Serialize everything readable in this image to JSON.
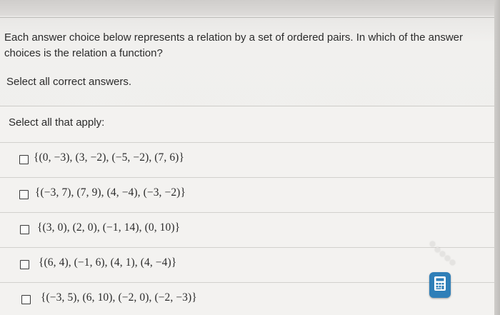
{
  "question": {
    "text": "Each answer choice below represents a relation by a set of ordered pairs. In which of the answer choices is the relation a function?",
    "instruction": "Select all correct answers."
  },
  "answer_panel": {
    "label": "Select all that apply:",
    "options": [
      {
        "text": "{(0, −3), (3, −2), (−5, −2), (7, 6)}",
        "checked": false
      },
      {
        "text": "{(−3, 7), (7, 9), (4, −4), (−3, −2)}",
        "checked": false
      },
      {
        "text": "{(3, 0), (2, 0), (−1, 14), (0, 10)}",
        "checked": false
      },
      {
        "text": "{(6, 4), (−1, 6), (4, 1), (4, −4)}",
        "checked": false
      },
      {
        "text": "{(−3, 5), (6, 10), (−2, 0), (−2, −3)}",
        "checked": false
      }
    ]
  },
  "tools": {
    "calculator_icon": "calculator-icon",
    "accent_color": "#2f7fb8"
  }
}
